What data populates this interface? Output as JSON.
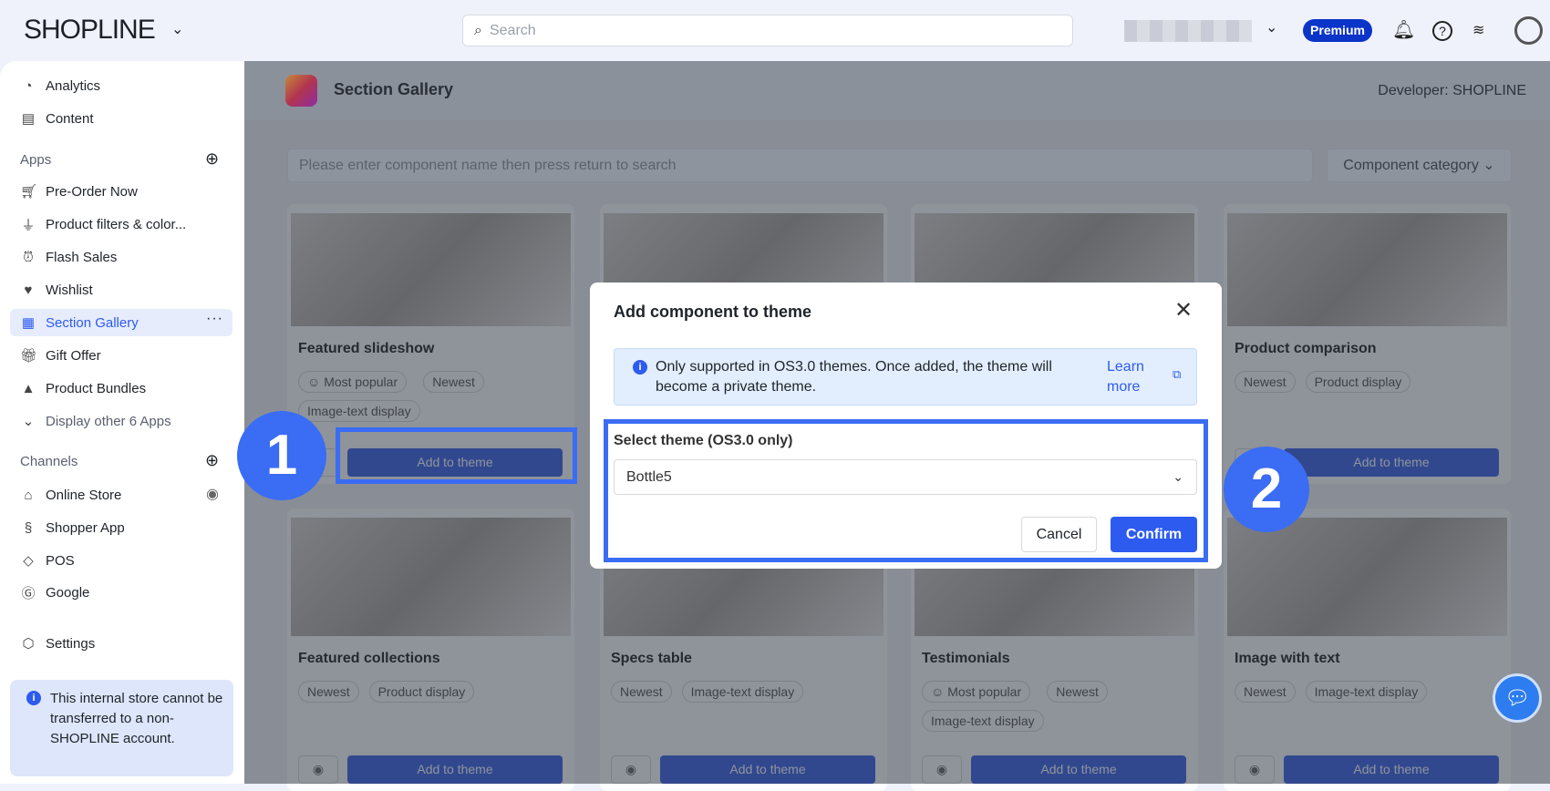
{
  "header": {
    "logo": "SHOPLINE",
    "search_placeholder": "Search",
    "plan_badge": "Premium"
  },
  "sidebar": {
    "items_top": [
      {
        "label": "Analytics",
        "icon": "chart-pie-icon"
      },
      {
        "label": "Content",
        "icon": "document-icon"
      }
    ],
    "apps_heading": "Apps",
    "apps": [
      {
        "label": "Pre-Order Now"
      },
      {
        "label": "Product filters & color..."
      },
      {
        "label": "Flash Sales"
      },
      {
        "label": "Wishlist"
      },
      {
        "label": "Section Gallery",
        "active": true
      },
      {
        "label": "Gift Offer"
      },
      {
        "label": "Product Bundles"
      }
    ],
    "display_other": "Display other 6 Apps",
    "channels_heading": "Channels",
    "channels": [
      {
        "label": "Online Store"
      },
      {
        "label": "Shopper App"
      },
      {
        "label": "POS"
      },
      {
        "label": "Google"
      }
    ],
    "settings": "Settings",
    "notice": "This internal store cannot be transferred to a non-SHOPLINE account."
  },
  "main": {
    "title": "Section Gallery",
    "developer": "Developer: SHOPLINE",
    "search_placeholder": "Please enter component name then press return to search",
    "category_label": "Component category",
    "add_label": "Add to theme",
    "cards": [
      {
        "title": "Featured slideshow",
        "tags": [
          "Most popular",
          "Newest",
          "Image-text display"
        ]
      },
      {
        "title": "",
        "tags": []
      },
      {
        "title": "",
        "tags": []
      },
      {
        "title": "Product comparison",
        "tags": [
          "Newest",
          "Product display"
        ]
      },
      {
        "title": "Featured collections",
        "tags": [
          "Newest",
          "Product display"
        ]
      },
      {
        "title": "Specs table",
        "tags": [
          "Newest",
          "Image-text display"
        ]
      },
      {
        "title": "Testimonials",
        "tags": [
          "Most popular",
          "Newest",
          "Image-text display"
        ]
      },
      {
        "title": "Image with text",
        "tags": [
          "Newest",
          "Image-text display"
        ]
      }
    ]
  },
  "modal": {
    "title": "Add component to theme",
    "notice": "Only supported in OS3.0 themes. Once added, the theme will become a private theme.",
    "learn_more": "Learn more",
    "select_label": "Select theme (OS3.0 only)",
    "selected_theme": "Bottle5",
    "cancel": "Cancel",
    "confirm": "Confirm"
  },
  "annotations": {
    "step1": "1",
    "step2": "2"
  },
  "colors": {
    "accent": "#3a6cf4",
    "premium": "#0b34c9",
    "confirm": "#2d5bf0"
  }
}
